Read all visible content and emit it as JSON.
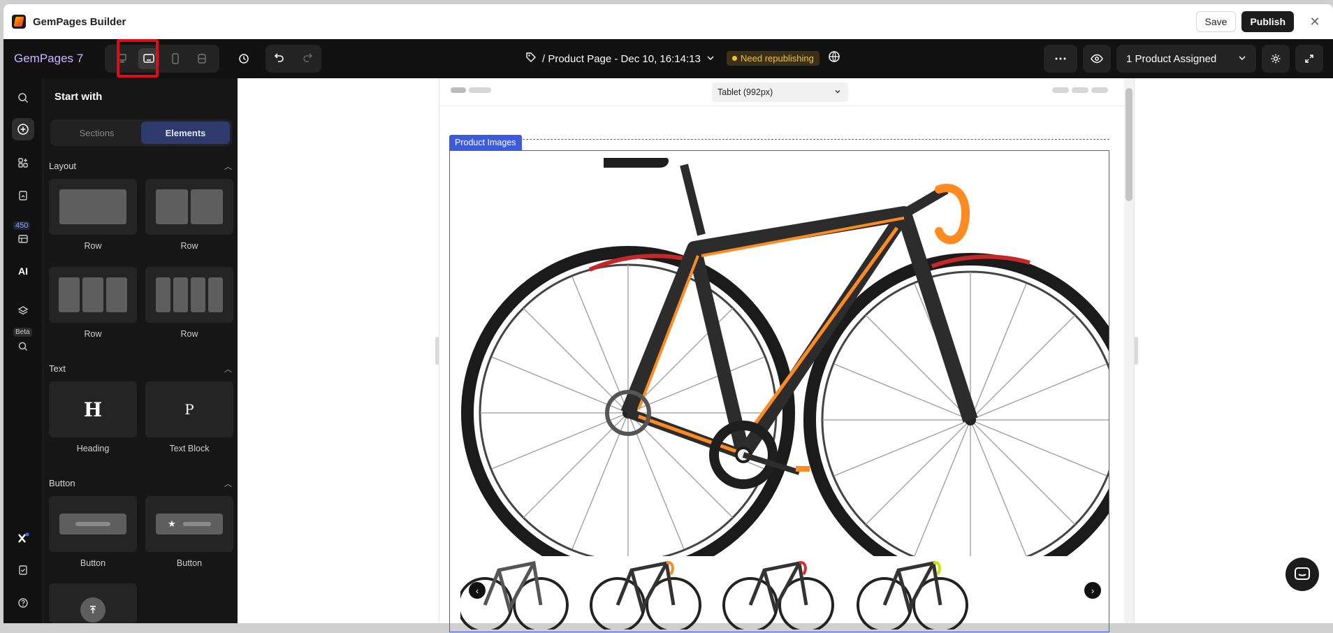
{
  "shell": {
    "app_title": "GemPages Builder",
    "save_label": "Save",
    "publish_label": "Publish"
  },
  "toolbar": {
    "brand": "GemPages 7",
    "page_title": "/ Product Page - Dec 10, 16:14:13",
    "status_badge": "Need republishing",
    "assigned_label": "1 Product Assigned"
  },
  "rail": {
    "badge_count": "450",
    "beta_label": "Beta",
    "ai_label": "AI"
  },
  "panel": {
    "title": "Start with",
    "tabs": [
      "Sections",
      "Elements"
    ],
    "active_tab": "Elements",
    "layout": {
      "heading": "Layout",
      "items": [
        "Row",
        "Row",
        "Row",
        "Row"
      ]
    },
    "text": {
      "heading": "Text",
      "items": [
        "Heading",
        "Text Block"
      ],
      "heading_glyph": "H",
      "text_glyph": "P"
    },
    "button": {
      "heading": "Button",
      "items": [
        "Button",
        "Button"
      ]
    }
  },
  "canvas": {
    "device_select": "Tablet (992px)",
    "element_label": "Product Images"
  },
  "colors": {
    "accent": "#3b5bdb",
    "highlight": "#e10b17",
    "badge": "#f7c12b",
    "brand": "#c9b8ff"
  }
}
